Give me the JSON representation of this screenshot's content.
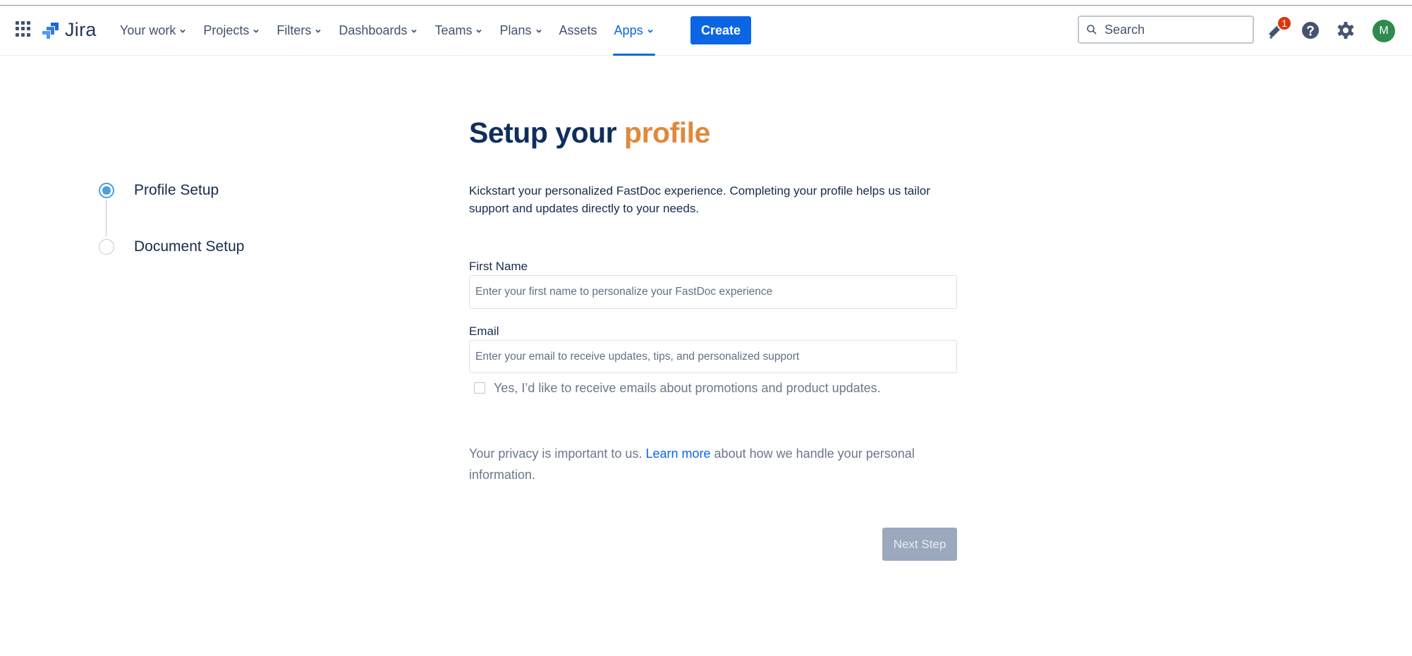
{
  "topbar": {
    "app_switcher_icon": "grid-icon",
    "logo_text": "Jira",
    "nav": [
      {
        "label": "Your work",
        "dropdown": true,
        "active": false
      },
      {
        "label": "Projects",
        "dropdown": true,
        "active": false
      },
      {
        "label": "Filters",
        "dropdown": true,
        "active": false
      },
      {
        "label": "Dashboards",
        "dropdown": true,
        "active": false
      },
      {
        "label": "Teams",
        "dropdown": true,
        "active": false
      },
      {
        "label": "Plans",
        "dropdown": true,
        "active": false
      },
      {
        "label": "Assets",
        "dropdown": false,
        "active": false
      },
      {
        "label": "Apps",
        "dropdown": true,
        "active": true
      }
    ],
    "create_label": "Create",
    "search_placeholder": "Search",
    "notifications_count": "1",
    "avatar_initial": "M"
  },
  "stepper": {
    "steps": [
      {
        "label": "Profile Setup",
        "state": "active"
      },
      {
        "label": "Document Setup",
        "state": "inactive"
      }
    ]
  },
  "form": {
    "title_main": "Setup your",
    "title_accent": "profile",
    "intro": "Kickstart your personalized FastDoc experience. Completing your profile helps us tailor support and updates directly to your needs.",
    "first_name_label": "First Name",
    "first_name_value": "",
    "first_name_placeholder": "Enter your first name to personalize your FastDoc experience",
    "email_label": "Email",
    "email_value": "",
    "email_placeholder": "Enter your email to receive updates, tips, and personalized support",
    "consent_label": "Yes, I’d like to receive emails about promotions and product updates.",
    "consent_checked": false,
    "privacy_prefix": "Your privacy is important to us.",
    "privacy_link": "Learn more",
    "privacy_suffix": "about how we handle your personal information.",
    "next_label": "Next Step"
  },
  "colors": {
    "accent": "#0c66e4",
    "title": "#0f2e5c",
    "title_accent": "#e0883b",
    "step_active": "#4a9fd8",
    "next_disabled": "#9aa9bd"
  }
}
